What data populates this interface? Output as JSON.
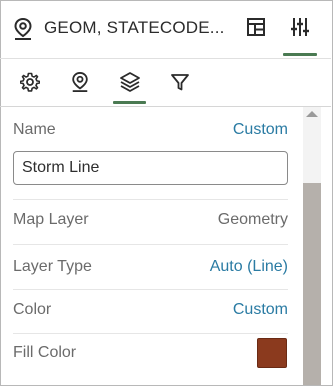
{
  "header": {
    "title": "GEOM, STATECODE...",
    "icons": {
      "location": "map-pin-icon",
      "layout": "layout-panel-icon",
      "properties": "sliders-icon"
    }
  },
  "tabs": [
    {
      "icon": "gear-icon"
    },
    {
      "icon": "map-pin-icon"
    },
    {
      "icon": "layers-icon",
      "selected": true
    },
    {
      "icon": "filter-icon"
    }
  ],
  "form": {
    "name": {
      "label": "Name",
      "value": "Custom",
      "input_value": "Storm Line"
    },
    "map_layer": {
      "label": "Map Layer",
      "value": "Geometry"
    },
    "layer_type": {
      "label": "Layer Type",
      "value": "Auto (Line)"
    },
    "color": {
      "label": "Color",
      "value": "Custom"
    },
    "fill_color": {
      "label": "Fill Color",
      "swatch": "#8b3a1e"
    }
  },
  "colors": {
    "accent": "#4a7a52",
    "link": "#2a7ba3"
  }
}
